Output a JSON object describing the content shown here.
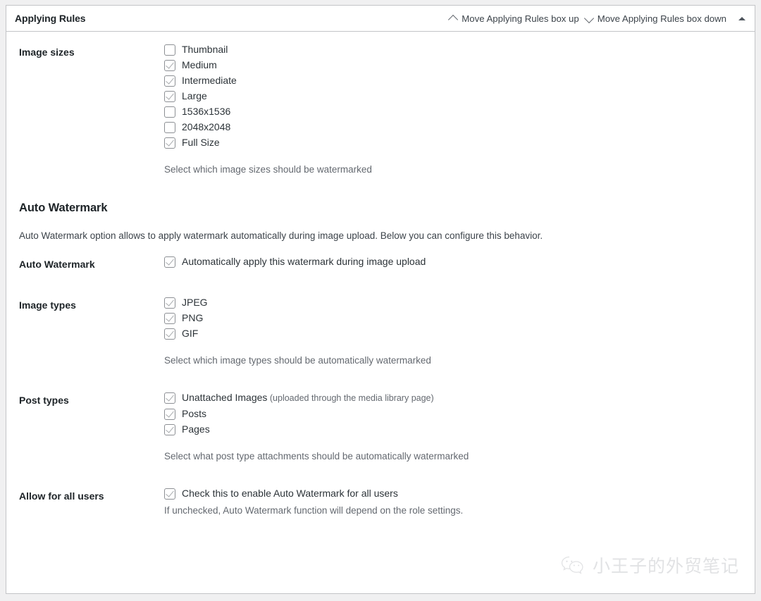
{
  "header": {
    "title": "Applying Rules",
    "move_up_label": "Move Applying Rules box up",
    "move_down_label": "Move Applying Rules box down"
  },
  "image_sizes": {
    "label": "Image sizes",
    "options": [
      {
        "label": "Thumbnail",
        "checked": false
      },
      {
        "label": "Medium",
        "checked": true
      },
      {
        "label": "Intermediate",
        "checked": true
      },
      {
        "label": "Large",
        "checked": true
      },
      {
        "label": "1536x1536",
        "checked": false
      },
      {
        "label": "2048x2048",
        "checked": false
      },
      {
        "label": "Full Size",
        "checked": true
      }
    ],
    "description": "Select which image sizes should be watermarked"
  },
  "auto_watermark_section": {
    "heading": "Auto Watermark",
    "description": "Auto Watermark option allows to apply watermark automatically during image upload. Below you can configure this behavior."
  },
  "auto_watermark": {
    "label": "Auto Watermark",
    "option_label": "Automatically apply this watermark during image upload",
    "checked": true
  },
  "image_types": {
    "label": "Image types",
    "options": [
      {
        "label": "JPEG",
        "checked": true
      },
      {
        "label": "PNG",
        "checked": true
      },
      {
        "label": "GIF",
        "checked": true
      }
    ],
    "description": "Select which image types should be automatically watermarked"
  },
  "post_types": {
    "label": "Post types",
    "options": [
      {
        "label": "Unattached Images",
        "sub": " (uploaded through the media library page)",
        "checked": true
      },
      {
        "label": "Posts",
        "sub": "",
        "checked": true
      },
      {
        "label": "Pages",
        "sub": "",
        "checked": true
      }
    ],
    "description": "Select what post type attachments should be automatically watermarked"
  },
  "allow_all_users": {
    "label": "Allow for all users",
    "option_label": "Check this to enable Auto Watermark for all users",
    "checked": true,
    "description": "If unchecked, Auto Watermark function will depend on the role settings."
  },
  "watermark": {
    "text": "小王子的外贸笔记",
    "icon": "wechat-logo"
  },
  "colors": {
    "card_border": "#c3c4c7",
    "page_bg": "#f0f0f1",
    "text": "#1d2327",
    "muted": "#646970"
  }
}
